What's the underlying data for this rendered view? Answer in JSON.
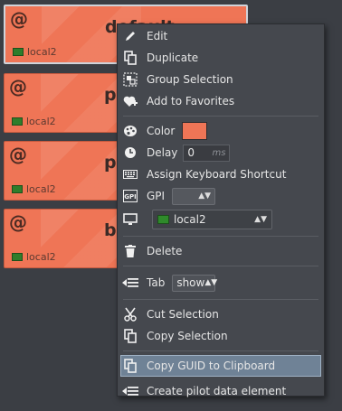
{
  "cards": [
    {
      "title": "default",
      "host": "local2",
      "selected": true
    },
    {
      "title": "pr",
      "host": "local2",
      "selected": false
    },
    {
      "title": "pr",
      "host": "local2",
      "selected": false
    },
    {
      "title": "bl",
      "host": "local2",
      "selected": false
    }
  ],
  "card_icon": "@",
  "menu": {
    "edit": "Edit",
    "duplicate": "Duplicate",
    "group_selection": "Group Selection",
    "add_favorites": "Add to Favorites",
    "color": "Color",
    "color_value": "#ef7556",
    "delay": "Delay",
    "delay_value": "0",
    "delay_unit": "ms",
    "assign_shortcut": "Assign Keyboard Shortcut",
    "gpi": "GPI",
    "gpi_value": "",
    "host_value": "local2",
    "delete": "Delete",
    "tab": "Tab",
    "tab_value": "show",
    "cut_selection": "Cut Selection",
    "copy_selection": "Copy Selection",
    "copy_guid": "Copy GUID to Clipboard",
    "create_pilot": "Create pilot data element"
  },
  "icons": {
    "edit": "pencil-icon",
    "duplicate": "duplicate-icon",
    "group": "group-icon",
    "favorites": "heart-plus-icon",
    "color": "palette-icon",
    "delay": "clock-icon",
    "keyboard": "keyboard-icon",
    "gpi": "gpi-icon",
    "monitor": "monitor-icon",
    "delete": "trash-icon",
    "tab": "tab-icon",
    "cut": "scissors-icon",
    "copy": "copy-icon",
    "pilot": "pilot-icon"
  }
}
